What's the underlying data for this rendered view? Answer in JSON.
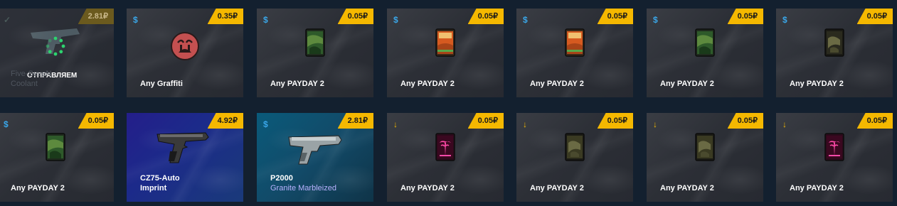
{
  "cards": [
    {
      "price": "2.81₽",
      "name": "Five-SeveN",
      "skin": "Coolant",
      "status": "ОТПРАВЛЯЕМ"
    },
    {
      "price": "0.35₽",
      "name": "Any Graffiti"
    },
    {
      "price": "0.05₽",
      "name": "Any PAYDAY 2"
    },
    {
      "price": "0.05₽",
      "name": "Any PAYDAY 2"
    },
    {
      "price": "0.05₽",
      "name": "Any PAYDAY 2"
    },
    {
      "price": "0.05₽",
      "name": "Any PAYDAY 2"
    },
    {
      "price": "0.05₽",
      "name": "Any PAYDAY 2"
    },
    {
      "price": "0.05₽",
      "name": "Any PAYDAY 2"
    },
    {
      "price": "4.92₽",
      "name": "CZ75-Auto",
      "skin": "Imprint"
    },
    {
      "price": "2.81₽",
      "name": "P2000",
      "skin": "Granite Marbleized"
    },
    {
      "price": "0.05₽",
      "name": "Any PAYDAY 2"
    },
    {
      "price": "0.05₽",
      "name": "Any PAYDAY 2"
    },
    {
      "price": "0.05₽",
      "name": "Any PAYDAY 2"
    },
    {
      "price": "0.05₽",
      "name": "Any PAYDAY 2"
    }
  ],
  "icons": {
    "dollar": "$",
    "arrow": "↓",
    "check": "✓"
  },
  "colors": {
    "price_badge": "#f5b800",
    "dollar_icon": "#3aa6e8",
    "arrow_icon": "#f5b800",
    "skin_purple": "#b9b2ff"
  }
}
